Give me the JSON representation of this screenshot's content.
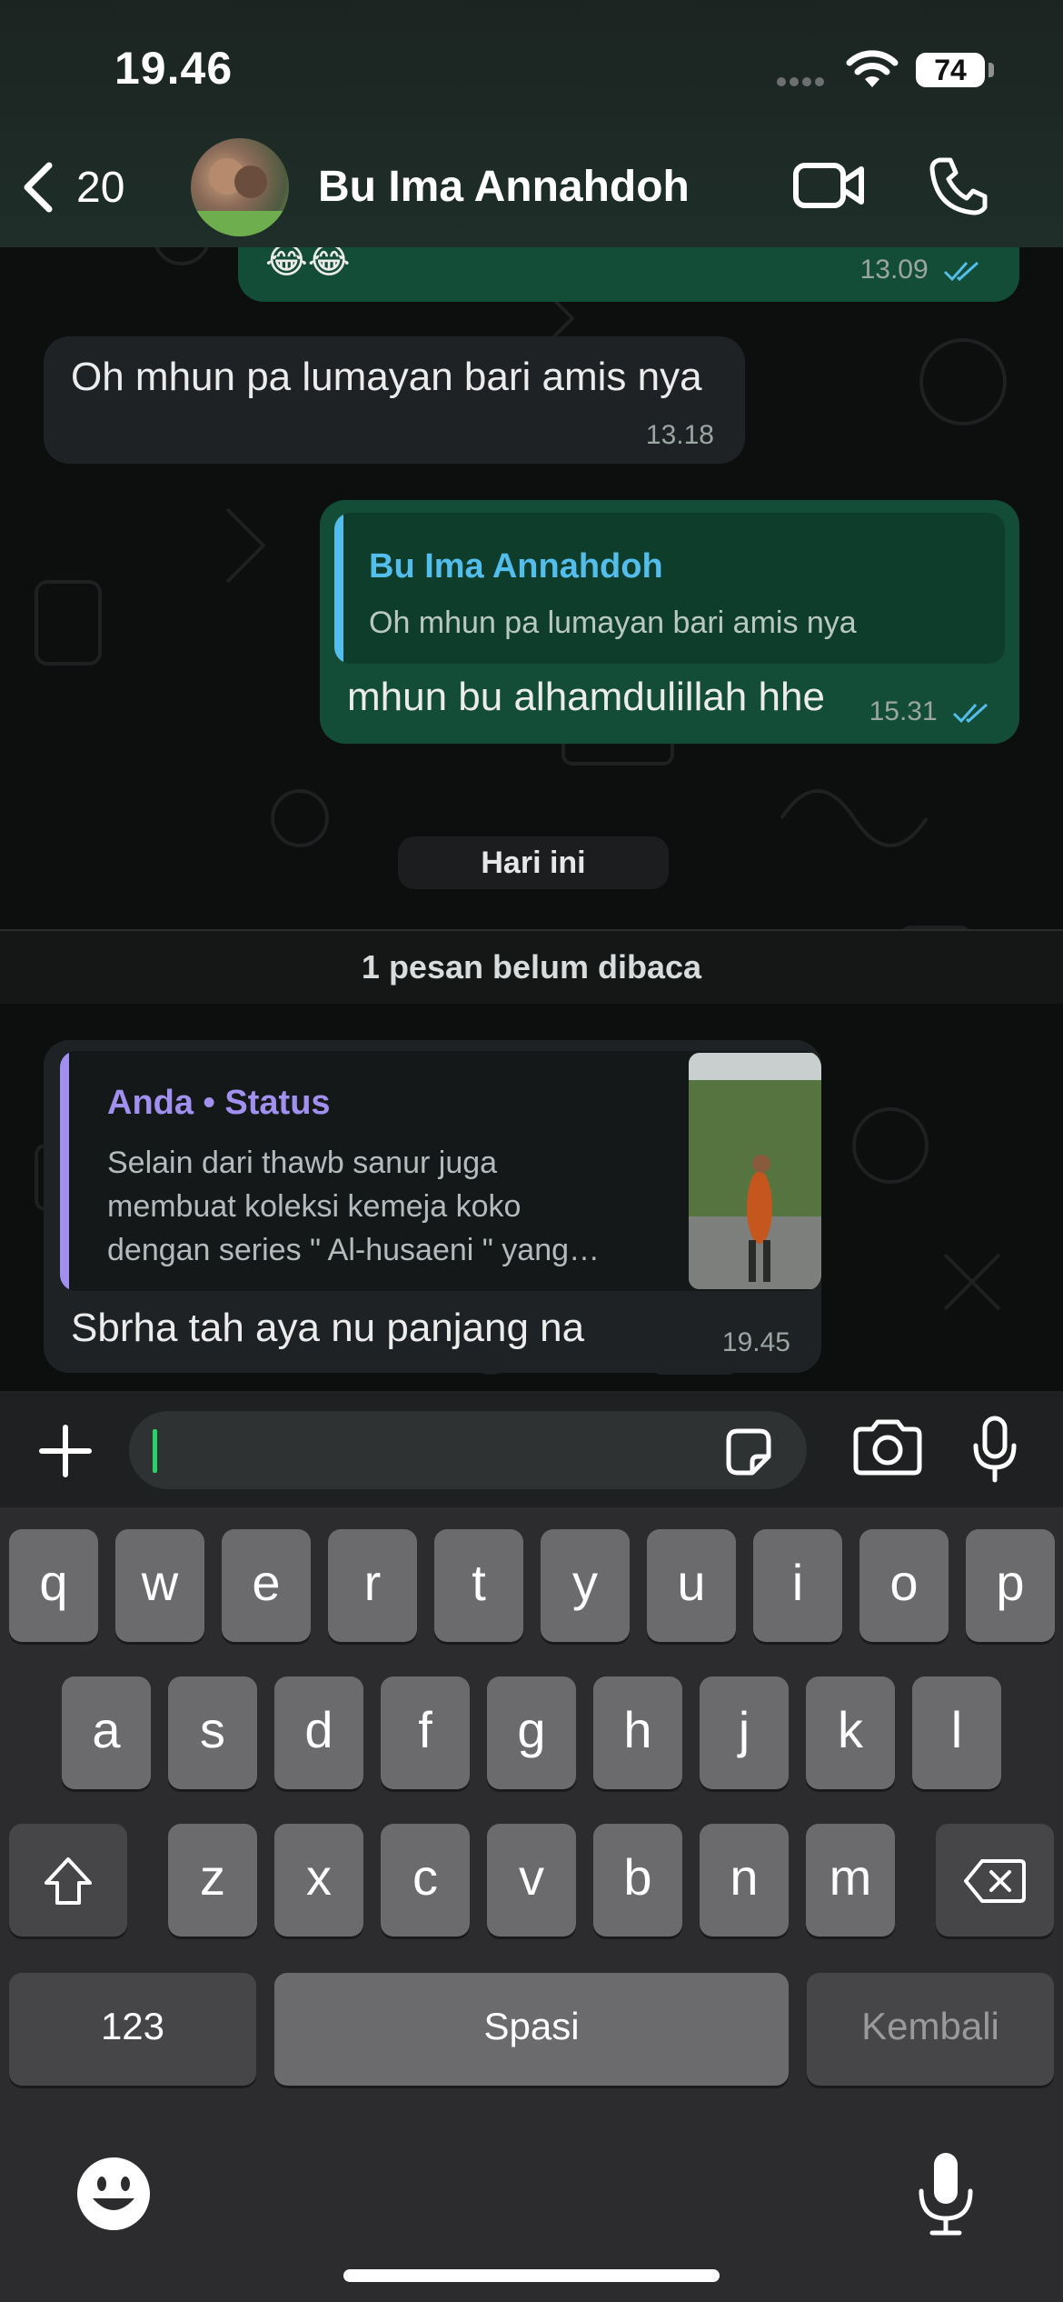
{
  "status_bar": {
    "time": "19.46",
    "battery": "74"
  },
  "header": {
    "back_count": "20",
    "contact_name": "Bu Ima Annahdoh"
  },
  "messages": [
    {
      "direction": "out",
      "text": "😂😂",
      "time": "13.09",
      "status": "read"
    },
    {
      "direction": "in",
      "text": "Oh mhun pa lumayan bari amis nya",
      "time": "13.18"
    },
    {
      "direction": "out",
      "reply_to": {
        "name": "Bu Ima Annahdoh",
        "text": "Oh mhun pa lumayan bari amis nya"
      },
      "text": "mhun bu alhamdulillah hhe",
      "time": "15.31",
      "status": "read"
    }
  ],
  "date_separator": "Hari ini",
  "unread_banner": "1 pesan belum dibaca",
  "status_reply": {
    "title": "Anda • Status",
    "lines": [
      "Selain dari thawb sanur juga",
      "membuat koleksi kemeja koko",
      "dengan series \" Al-husaeni \" yang…"
    ],
    "text": "Sbrha tah aya nu panjang na",
    "time": "19.45"
  },
  "composer": {
    "value": ""
  },
  "keyboard": {
    "row1": [
      "q",
      "w",
      "e",
      "r",
      "t",
      "y",
      "u",
      "i",
      "o",
      "p"
    ],
    "row2": [
      "a",
      "s",
      "d",
      "f",
      "g",
      "h",
      "j",
      "k",
      "l"
    ],
    "row3": [
      "z",
      "x",
      "c",
      "v",
      "b",
      "n",
      "m"
    ],
    "numbers_label": "123",
    "space_label": "Spasi",
    "return_label": "Kembali"
  },
  "colors": {
    "outgoing_bubble": "#144d37",
    "incoming_bubble": "#1f2224",
    "accent_blue": "#53bdeb",
    "status_purple": "#a190f0"
  }
}
